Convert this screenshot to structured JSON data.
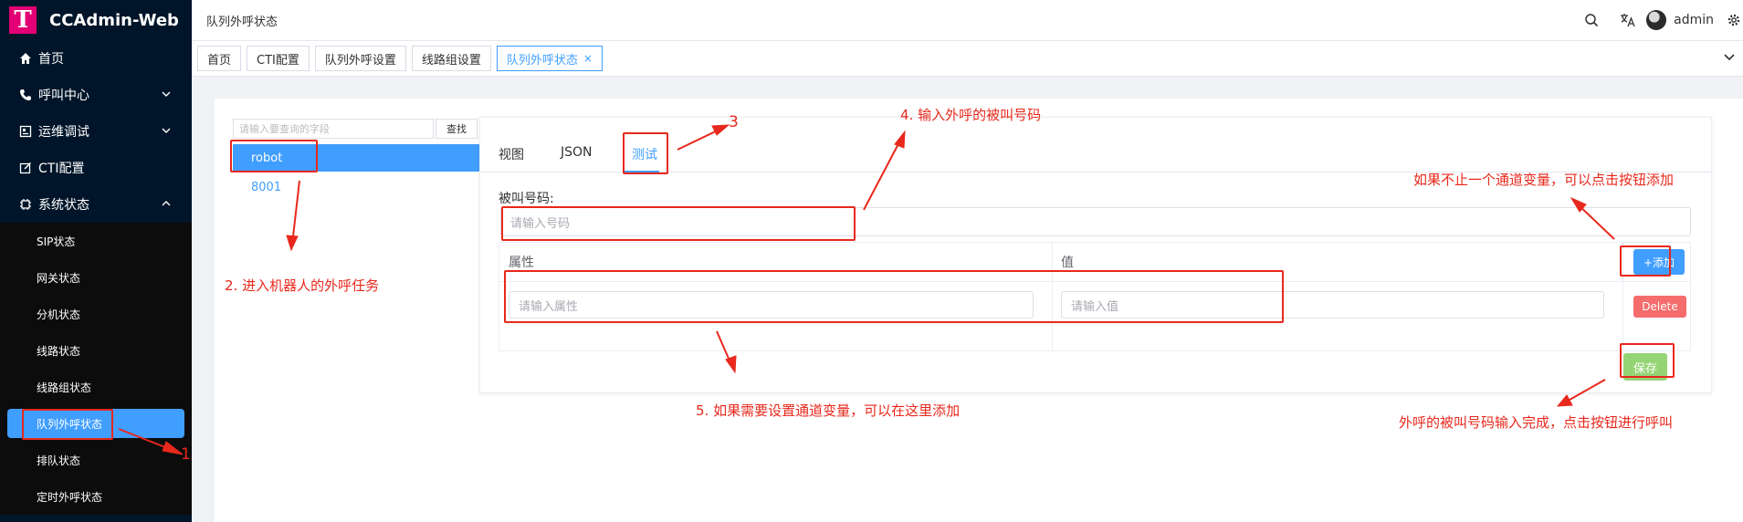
{
  "app": {
    "title": "CCAdmin-Web",
    "logo_letter": "T"
  },
  "sidebar": {
    "items": [
      {
        "label": "首页",
        "icon": "home-icon"
      },
      {
        "label": "呼叫中心",
        "icon": "phone-icon"
      },
      {
        "label": "运维调试",
        "icon": "debug-icon"
      },
      {
        "label": "CTI配置",
        "icon": "edit-icon"
      },
      {
        "label": "系统状态",
        "icon": "cpu-icon"
      }
    ],
    "sub_items": [
      "SIP状态",
      "网关状态",
      "分机状态",
      "线路状态",
      "线路组状态",
      "队列外呼状态",
      "排队状态",
      "定时外呼状态"
    ]
  },
  "header": {
    "breadcrumb": "队列外呼状态",
    "username": "admin"
  },
  "tabs": [
    "首页",
    "CTI配置",
    "队列外呼设置",
    "线路组设置",
    "队列外呼状态"
  ],
  "search": {
    "placeholder": "请输入要查询的字段",
    "button": "查找"
  },
  "list": [
    "robot",
    "8001"
  ],
  "panel": {
    "tabs": [
      "视图",
      "JSON",
      "测试"
    ],
    "callee_label": "被叫号码:",
    "callee_placeholder": "请输入号码",
    "col_attr": "属性",
    "col_value": "值",
    "attr_placeholder": "请输入属性",
    "value_placeholder": "请输入值",
    "add_button": "+添加",
    "delete_button": "Delete",
    "save_button": "保存"
  },
  "annotations": {
    "a1": "1",
    "a2": "2. 进入机器人的外呼任务",
    "a3": "3",
    "a4": "4. 输入外呼的被叫号码",
    "a5": "5. 如果需要设置通道变量，可以在这里添加",
    "a6": "如果不止一个通道变量，可以点击按钮添加",
    "a7": "外呼的被叫号码输入完成，点击按钮进行呼叫"
  },
  "colors": {
    "accent": "#409eff",
    "sidebar": "#001529",
    "annotation": "#e8281c",
    "brand": "#e20074"
  }
}
